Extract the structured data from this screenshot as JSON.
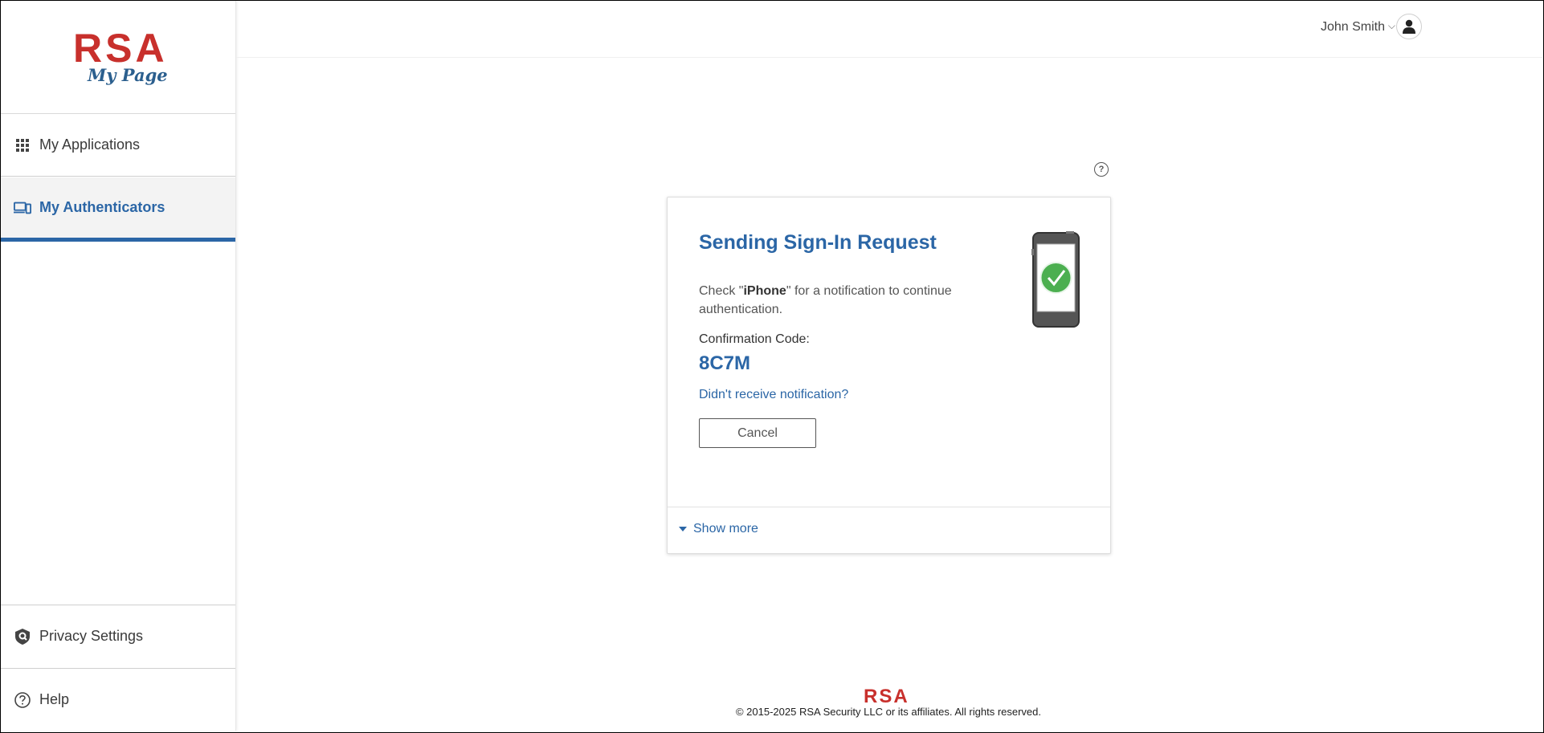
{
  "brand": {
    "logo_text": "RSA",
    "product": "My Page"
  },
  "sidebar": {
    "items": [
      {
        "label": "My Applications",
        "icon": "grid-icon"
      },
      {
        "label": "My Authenticators",
        "icon": "devices-icon",
        "active": true
      },
      {
        "label": "Privacy Settings",
        "icon": "shield-icon"
      },
      {
        "label": "Help",
        "icon": "help-circle-icon"
      }
    ]
  },
  "header": {
    "user_name": "John Smith",
    "chevron": "⌵"
  },
  "card": {
    "title": "Sending Sign-In Request",
    "msg_prefix": "Check \"",
    "device": "iPhone",
    "msg_suffix": "\" for a notification to continue authentication.",
    "confirmation_label": "Confirmation Code:",
    "confirmation_code": "8C7M",
    "didnt_receive": "Didn't receive notification?",
    "cancel_label": "Cancel",
    "show_more": "Show more",
    "help_glyph": "?"
  },
  "footer": {
    "logo_text": "RSA",
    "copyright": "© 2015-2025 RSA Security LLC or its affiliates. All rights reserved."
  },
  "colors": {
    "accent": "#2b66a6",
    "brand_red": "#c8302c",
    "success_green": "#4caf50"
  }
}
